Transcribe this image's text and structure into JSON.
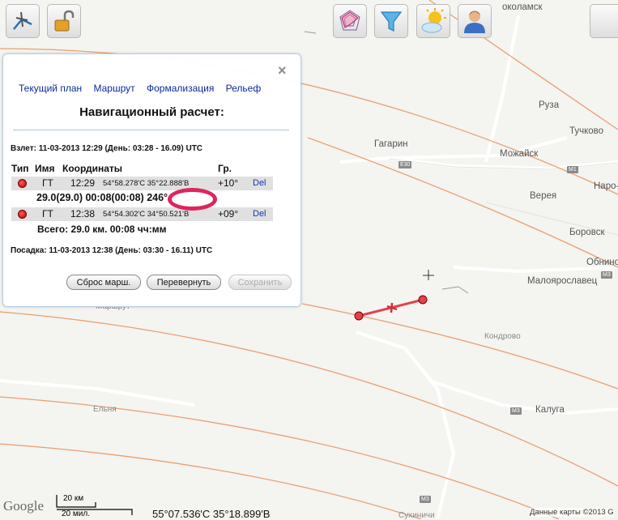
{
  "map": {
    "towns": [
      {
        "name": "Гагарин",
        "id": "gagarin"
      },
      {
        "name": "Можайск",
        "id": "mozhaysk"
      },
      {
        "name": "Руза",
        "id": "ruza"
      },
      {
        "name": "Тучково",
        "id": "tuchkovo"
      },
      {
        "name": "Наро-",
        "id": "naro"
      },
      {
        "name": "Верея",
        "id": "vereya"
      },
      {
        "name": "Боровск",
        "id": "borovsk"
      },
      {
        "name": "Обнино",
        "id": "obninsk"
      },
      {
        "name": "Малоярославец",
        "id": "maloyaroslavets"
      },
      {
        "name": "Кондрово",
        "id": "kondrovo"
      },
      {
        "name": "Калуга",
        "id": "kaluga"
      },
      {
        "name": "Сухиничи",
        "id": "sukhinichi"
      },
      {
        "name": "Ельня",
        "id": "elnya"
      },
      {
        "name": "Маршрут",
        "id": "marshrut"
      },
      {
        "name": "околамск",
        "id": "volokolamsk"
      }
    ],
    "shields": [
      "E30",
      "M1",
      "M3",
      "M3",
      "M3"
    ],
    "cursor_coordinates": "55°07.536'С 35°18.899'В",
    "scale_top": "20 км",
    "scale_bottom": "20 мил.",
    "copyright": "Данные карты ©2013 G",
    "logo": "Google"
  },
  "toolbar": {
    "left": [
      "route-tool-icon",
      "unlock-icon"
    ],
    "right": [
      "radar-icon",
      "filter-icon",
      "weather-icon",
      "user-icon"
    ]
  },
  "panel": {
    "close": "×",
    "tabs": [
      "Текущий план",
      "Маршрут",
      "Формализация",
      "Рельеф"
    ],
    "title": "Навигационный расчет:",
    "takeoff": "Взлет: 11-03-2013 12:29 (День: 03:28 - 16.09) UTC",
    "headers": {
      "type": "Тип",
      "name": "Имя",
      "coords": "Координаты",
      "deg": "Гр."
    },
    "points": [
      {
        "name": "ГТ",
        "time": "12:29",
        "coord": "54°58.278'С 35°22.888'В",
        "deg": "+10°",
        "del": "Del"
      },
      {
        "name": "ГТ",
        "time": "12:38",
        "coord": "54°54.302'С 34°50.521'В",
        "deg": "+09°",
        "del": "Del"
      }
    ],
    "segment": "29.0(29.0) 00:08(00:08) 246°",
    "total": "Всего: 29.0 км. 00:08 чч:мм",
    "landing": "Посадка: 11-03-2013 12:38 (День: 03:30 - 16.11) UTC",
    "buttons": {
      "reset": "Сброс марш.",
      "flip": "Перевернуть",
      "save": "Сохранить"
    }
  },
  "colors": {
    "route": "#e2424b",
    "circle": "#e0245e",
    "tab_link": "#0b2a9a",
    "del_link": "#1535b8",
    "lines": "#e8a070"
  }
}
